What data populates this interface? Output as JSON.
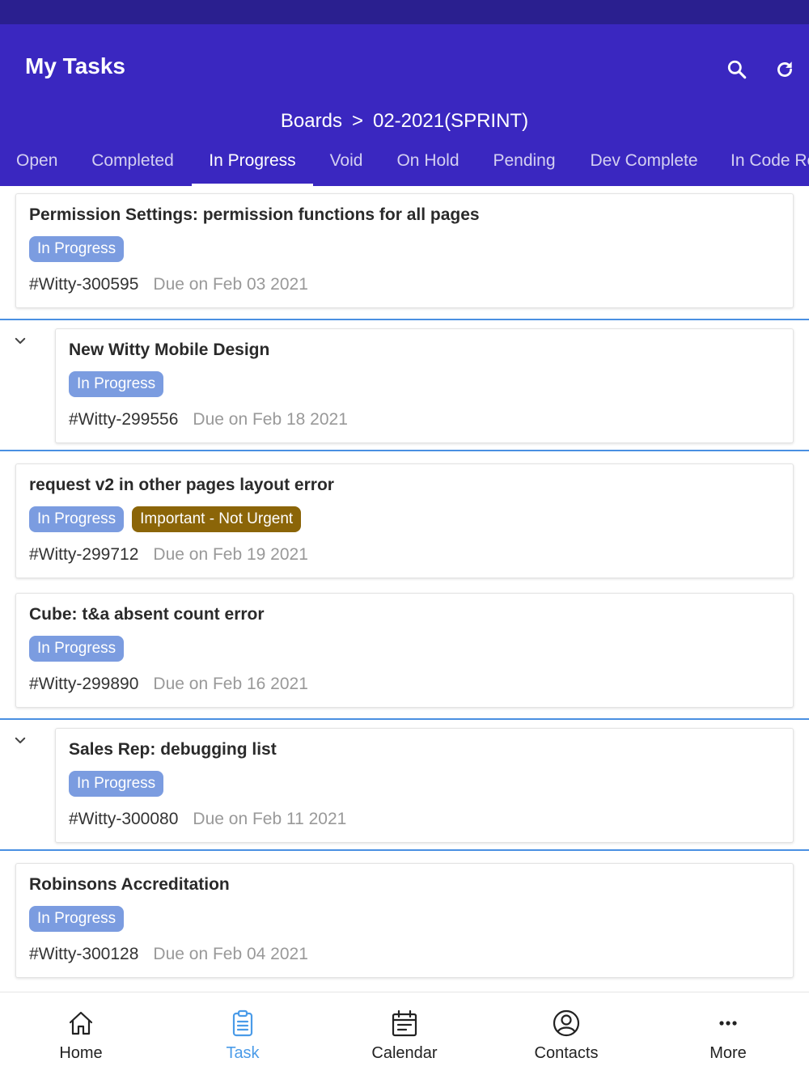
{
  "header": {
    "title": "My Tasks",
    "search_icon": "search-icon",
    "refresh_icon": "refresh-icon"
  },
  "breadcrumb": {
    "root": "Boards",
    "separator": ">",
    "current": "02-2021(SPRINT)"
  },
  "tabs": [
    {
      "label": "Open"
    },
    {
      "label": "Completed"
    },
    {
      "label": "In Progress",
      "active": true
    },
    {
      "label": "Void"
    },
    {
      "label": "On Hold"
    },
    {
      "label": "Pending"
    },
    {
      "label": "Dev Complete"
    },
    {
      "label": "In Code Re"
    }
  ],
  "tasks": [
    {
      "title": "Permission Settings: permission functions for all pages",
      "status": "In Progress",
      "id": "#Witty-300595",
      "due": "Due on Feb 03 2021"
    },
    {
      "title": "New Witty Mobile Design",
      "status": "In Progress",
      "id": "#Witty-299556",
      "due": "Due on Feb 18 2021",
      "collapsible": true
    },
    {
      "title": "request v2 in other pages layout error",
      "status": "In Progress",
      "priority": "Important - Not Urgent",
      "id": "#Witty-299712",
      "due": "Due on Feb 19 2021"
    },
    {
      "title": "Cube: t&a absent count error",
      "status": "In Progress",
      "id": "#Witty-299890",
      "due": "Due on Feb 16 2021"
    },
    {
      "title": "Sales Rep: debugging list",
      "status": "In Progress",
      "id": "#Witty-300080",
      "due": "Due on Feb 11 2021",
      "collapsible": true
    },
    {
      "title": "Robinsons Accreditation",
      "status": "In Progress",
      "id": "#Witty-300128",
      "due": "Due on Feb 04 2021"
    }
  ],
  "bottom_nav": [
    {
      "label": "Home",
      "icon": "home-icon"
    },
    {
      "label": "Task",
      "icon": "clipboard-icon",
      "active": true
    },
    {
      "label": "Calendar",
      "icon": "calendar-icon"
    },
    {
      "label": "Contacts",
      "icon": "user-circle-icon"
    },
    {
      "label": "More",
      "icon": "more-icon"
    }
  ],
  "colors": {
    "header_bg": "#3a27c0",
    "status_bar": "#2a1f8f",
    "status_chip": "#7b9ce0",
    "priority_chip": "#8b6508",
    "divider": "#4a90e2",
    "active_nav": "#4a9be8"
  }
}
